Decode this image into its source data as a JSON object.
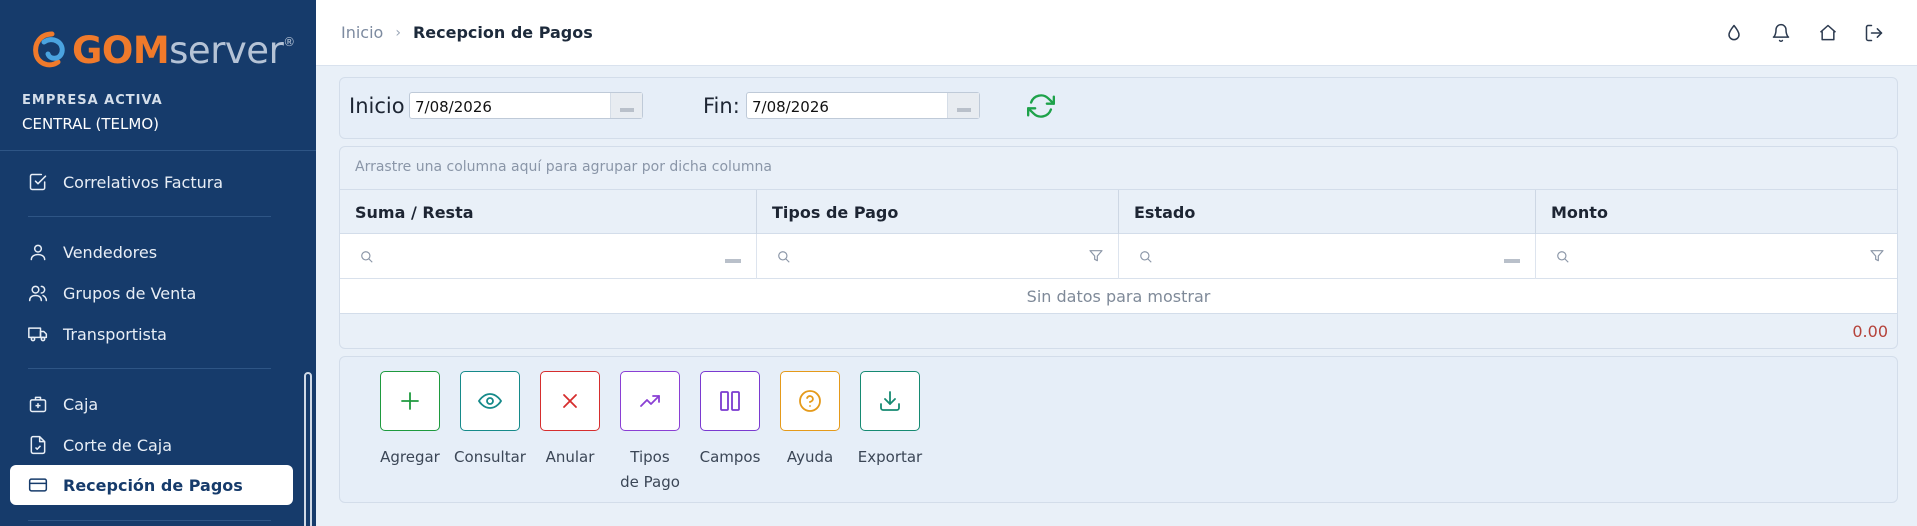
{
  "brand": {
    "name_part1": "GOM",
    "name_part2": "server",
    "mark": "®"
  },
  "empresa": {
    "label": "EMPRESA ACTIVA",
    "name": "CENTRAL (TELMO)"
  },
  "sidebar": {
    "items": [
      {
        "label": "Correlativos Factura",
        "icon": "checkbox-icon"
      },
      {
        "label": "Vendedores",
        "icon": "user-icon"
      },
      {
        "label": "Grupos de Venta",
        "icon": "users-icon"
      },
      {
        "label": "Transportista",
        "icon": "truck-icon"
      },
      {
        "label": "Caja",
        "icon": "briefcase-plus-icon"
      },
      {
        "label": "Corte de Caja",
        "icon": "file-check-icon"
      },
      {
        "label": "Recepción de Pagos",
        "icon": "credit-card-icon",
        "active": true
      }
    ]
  },
  "breadcrumb": {
    "home": "Inicio",
    "separator": "›",
    "current": "Recepcion de Pagos"
  },
  "topbar_icons": [
    "drop-icon",
    "bell-icon",
    "home-icon",
    "logout-icon"
  ],
  "filters": {
    "start_label": "Inicio",
    "start_value": "7/08/2026",
    "end_label": "Fin:",
    "end_value": "7/08/2026"
  },
  "grid": {
    "group_hint": "Arrastre una columna aquí para agrupar por dicha columna",
    "columns": [
      "Suma / Resta",
      "Tipos de Pago",
      "Estado",
      "Monto"
    ],
    "empty_text": "Sin datos para mostrar",
    "total": "0.00"
  },
  "actions": [
    {
      "label": "Agregar",
      "color": "#1e9a3e"
    },
    {
      "label": "Consultar",
      "color": "#168a8a"
    },
    {
      "label": "Anular",
      "color": "#d62e2e"
    },
    {
      "label": "Tipos de Pago",
      "color": "#8a3fd4"
    },
    {
      "label": "Campos",
      "color": "#7a3ad0"
    },
    {
      "label": "Ayuda",
      "color": "#e59a1a"
    },
    {
      "label": "Exportar",
      "color": "#168a72"
    }
  ],
  "colors": {
    "sidebar_bg": "#163b6b",
    "accent_orange": "#f07a2b",
    "refresh_green": "#1ea24a",
    "total_red": "#b5423a"
  }
}
